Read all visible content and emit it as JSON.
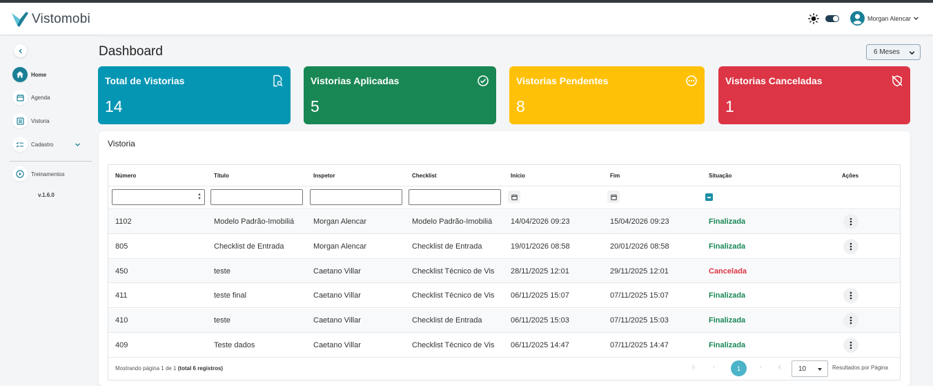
{
  "app": {
    "name": "Vistomobi"
  },
  "user": {
    "name": "Morgan Alencar"
  },
  "colors": {
    "primary": "#1a7f96",
    "blue": "#0596b4",
    "green": "#198754",
    "yellow": "#ffc107",
    "red": "#dc3545"
  },
  "sidebar": {
    "items": [
      {
        "label": "Home",
        "icon": "home-icon",
        "active": true
      },
      {
        "label": "Agenda",
        "icon": "calendar-icon"
      },
      {
        "label": "Vistoria",
        "icon": "list-icon"
      },
      {
        "label": "Cadastro",
        "icon": "checklist-icon",
        "expandable": true
      },
      {
        "label": "Treinamentos",
        "icon": "play-icon"
      }
    ],
    "version": "v.1.6.0"
  },
  "header": {
    "title": "Dashboard",
    "period": "6 Meses"
  },
  "cards": [
    {
      "title": "Total de Vistorias",
      "value": "14",
      "icon": "search-document-icon"
    },
    {
      "title": "Vistorias Aplicadas",
      "value": "5",
      "icon": "check-circle-icon"
    },
    {
      "title": "Vistorias Pendentes",
      "value": "8",
      "icon": "dots-circle-icon"
    },
    {
      "title": "Vistorias Canceladas",
      "value": "1",
      "icon": "cancel-icon"
    }
  ],
  "table": {
    "title": "Vistoria",
    "columns": [
      "Número",
      "Título",
      "Inspetor",
      "Checklist",
      "Início",
      "Fim",
      "Situação",
      "Ações"
    ],
    "rows": [
      {
        "numero": "1102",
        "titulo": "Modelo Padrão-Imobiliá",
        "inspetor": "Morgan Alencar",
        "checklist": "Modelo Padrão-Imobiliá",
        "inicio": "14/04/2026 09:23",
        "fim": "15/04/2026 09:23",
        "situacao": "Finalizada",
        "actions": true
      },
      {
        "numero": "805",
        "titulo": "Checklist de Entrada",
        "inspetor": "Morgan Alencar",
        "checklist": "Checklist de Entrada",
        "inicio": "19/01/2026 08:58",
        "fim": "20/01/2026 08:58",
        "situacao": "Finalizada",
        "actions": true
      },
      {
        "numero": "450",
        "titulo": "teste",
        "inspetor": "Caetano Villar",
        "checklist": "Checklist Técnico de Vis",
        "inicio": "28/11/2025 12:01",
        "fim": "29/11/2025 12:01",
        "situacao": "Cancelada",
        "actions": false
      },
      {
        "numero": "411",
        "titulo": "teste final",
        "inspetor": "Caetano Villar",
        "checklist": "Checklist Técnico de Vis",
        "inicio": "06/11/2025 15:07",
        "fim": "07/11/2025 15:07",
        "situacao": "Finalizada",
        "actions": true
      },
      {
        "numero": "410",
        "titulo": "teste",
        "inspetor": "Caetano Villar",
        "checklist": "Checklist de Entrada",
        "inicio": "06/11/2025 15:03",
        "fim": "07/11/2025 15:03",
        "situacao": "Finalizada",
        "actions": true
      },
      {
        "numero": "409",
        "titulo": "Teste dados",
        "inspetor": "Caetano Villar",
        "checklist": "Checklist Técnico de Vis",
        "inicio": "06/11/2025 14:47",
        "fim": "07/11/2025 14:47",
        "situacao": "Finalizada",
        "actions": true
      }
    ],
    "footer": {
      "showing": "Mostrando página 1 de 1",
      "total": "(total 6 registros)",
      "current_page": "1",
      "per_page": "10",
      "per_page_label": "Resultados por Página"
    }
  }
}
